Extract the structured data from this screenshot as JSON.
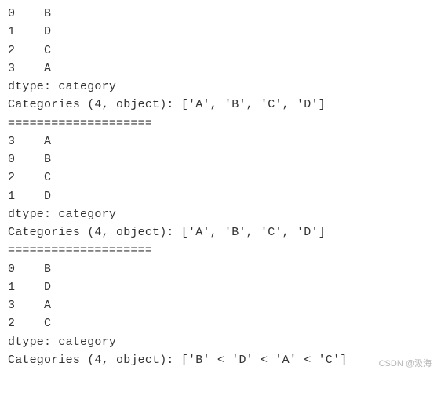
{
  "block1": {
    "rows": [
      {
        "idx": "0",
        "val": "B"
      },
      {
        "idx": "1",
        "val": "D"
      },
      {
        "idx": "2",
        "val": "C"
      },
      {
        "idx": "3",
        "val": "A"
      }
    ],
    "dtype": "dtype: category",
    "categories": "Categories (4, object): ['A', 'B', 'C', 'D']"
  },
  "sep1": "====================",
  "block2": {
    "rows": [
      {
        "idx": "3",
        "val": "A"
      },
      {
        "idx": "0",
        "val": "B"
      },
      {
        "idx": "2",
        "val": "C"
      },
      {
        "idx": "1",
        "val": "D"
      }
    ],
    "dtype": "dtype: category",
    "categories": "Categories (4, object): ['A', 'B', 'C', 'D']"
  },
  "sep2": "====================",
  "block3": {
    "rows": [
      {
        "idx": "0",
        "val": "B"
      },
      {
        "idx": "1",
        "val": "D"
      },
      {
        "idx": "3",
        "val": "A"
      },
      {
        "idx": "2",
        "val": "C"
      }
    ],
    "dtype": "dtype: category",
    "categories": "Categories (4, object): ['B' < 'D' < 'A' < 'C']"
  },
  "watermark": "CSDN @汲海"
}
